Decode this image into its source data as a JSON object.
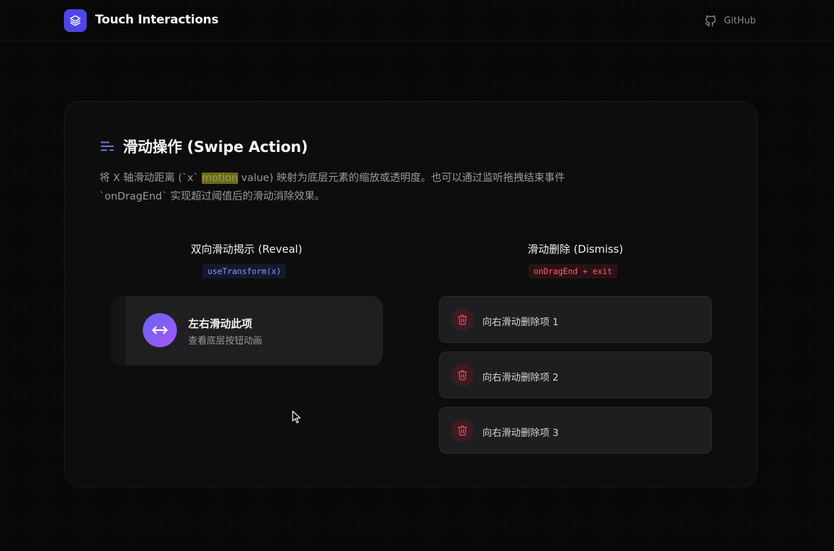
{
  "header": {
    "brand": "Touch Interactions",
    "github_label": "GitHub"
  },
  "section": {
    "title": "滑动操作 (Swipe Action)",
    "desc_part1": "将 X 轴滑动距离 (`x` ",
    "desc_highlight": "motion",
    "desc_part2": " value) 映射为底层元素的缩放或透明度。也可以通过监听拖拽结束事件 `onDragEnd` 实现超过阈值后的滑动消除效果。"
  },
  "reveal": {
    "title": "双向滑动揭示 (Reveal)",
    "code": "useTransform(x)",
    "item_title": "左右滑动此项",
    "item_sub": "查看底层按钮动画",
    "icon_glyph": "⟷"
  },
  "dismiss": {
    "title": "滑动删除 (Dismiss)",
    "code": "onDragEnd + exit",
    "items": [
      {
        "label": "向右滑动删除项 1"
      },
      {
        "label": "向右滑动删除项 2"
      },
      {
        "label": "向右滑动删除项 3"
      }
    ]
  },
  "colors": {
    "accent": "#4f46e5",
    "danger": "#f43f5e",
    "reveal_gradient_start": "#6366f1",
    "reveal_gradient_end": "#a855f7"
  },
  "icons": {
    "logo": "layers-icon",
    "github": "github-icon",
    "section": "align-lines-icon",
    "reveal": "arrows-horizontal-icon",
    "dismiss": "trash-icon"
  }
}
